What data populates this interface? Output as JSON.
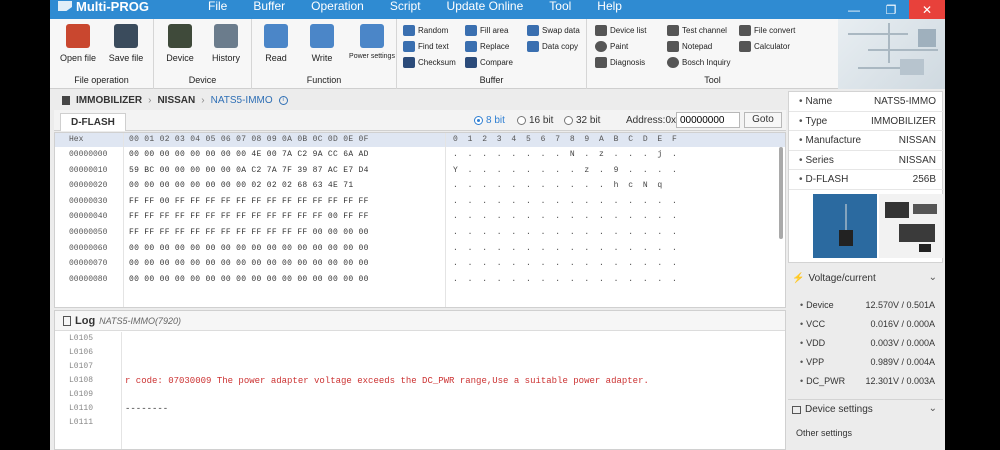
{
  "window": {
    "app_title": "Multi-PROG",
    "menus": [
      "File",
      "Buffer",
      "Operation",
      "Script",
      "Update Online",
      "Tool",
      "Help"
    ],
    "min_glyph": "—",
    "max_glyph": "❐",
    "close_glyph": "✕"
  },
  "ribbon": {
    "file_operation": {
      "label": "File operation",
      "open": "Open file",
      "save": "Save file"
    },
    "device": {
      "label": "Device",
      "device": "Device",
      "history": "History"
    },
    "function": {
      "label": "Function",
      "read": "Read",
      "write": "Write",
      "power": "Power settings"
    },
    "buffer": {
      "label": "Buffer",
      "random": "Random",
      "find_text": "Find text",
      "checksum": "Checksum",
      "fill_area": "Fill area",
      "replace": "Replace",
      "compare": "Compare",
      "swap_data": "Swap data",
      "data_copy": "Data copy"
    },
    "tool": {
      "label": "Tool",
      "device_list": "Device list",
      "paint": "Paint",
      "diagnosis": "Diagnosis",
      "test_channel": "Test channel",
      "notepad": "Notepad",
      "bosch_inquiry": "Bosch Inquiry",
      "file_convert": "File convert",
      "calculator": "Calculator"
    }
  },
  "breadcrumb": {
    "part1": "IMMOBILIZER",
    "part2": "NISSAN",
    "part3": "NATS5-IMMO"
  },
  "hex_view": {
    "tab": "D-FLASH",
    "bit_options": [
      "8 bit",
      "16 bit",
      "32 bit"
    ],
    "address_label": "Address:0x",
    "address_value": "00000000",
    "goto": "Goto",
    "header_hex": "Hex",
    "header_cols": "00 01 02 03 04 05 06 07 08 09 0A 0B 0C 0D 0E 0F",
    "header_ascii": "0 1 2 3 4 5 6 7 8 9 A B C D E F",
    "rows": [
      {
        "addr": "00000000",
        "hex": "00 00 00 00 00 00 00 00 4E 00 7A C2 9A CC 6A AD",
        "ascii": ". . . . . . . . N . z . . . j ."
      },
      {
        "addr": "00000010",
        "hex": "59 BC 00 00 00 00 00 0A C2 7A 7F 39 87 AC E7 D4",
        "ascii": "Y . . . . . . . . z . 9 . . . ."
      },
      {
        "addr": "00000020",
        "hex": "00 00 00 00 00 00 00 00 02 02 02 68 63 4E 71 ",
        "ascii": ". . . . . . . . . . . h c N q"
      },
      {
        "addr": "00000030",
        "hex": "FF FF 00 FF FF FF FF FF FF FF FF FF FF FF FF FF",
        "ascii": ". . . . . . . . . . . . . . . ."
      },
      {
        "addr": "00000040",
        "hex": "FF FF FF FF FF FF FF FF FF FF FF FF FF 00 FF FF",
        "ascii": ". . . . . . . . . . . . . . . ."
      },
      {
        "addr": "00000050",
        "hex": "FF FF FF FF FF FF FF FF FF FF FF FF 00 00 00 00",
        "ascii": ". . . . . . . . . . . . . . . ."
      },
      {
        "addr": "00000060",
        "hex": "00 00 00 00 00 00 00 00 00 00 00 00 00 00 00 00",
        "ascii": ". . . . . . . . . . . . . . . ."
      },
      {
        "addr": "00000070",
        "hex": "00 00 00 00 00 00 00 00 00 00 00 00 00 00 00 00",
        "ascii": ". . . . . . . . . . . . . . . ."
      },
      {
        "addr": "00000080",
        "hex": "00 00 00 00 00 00 00 00 00 00 00 00 00 00 00 00",
        "ascii": ". . . . . . . . . . . . . . . ."
      }
    ]
  },
  "log": {
    "title": "Log",
    "subtitle": "NATS5-IMMO(7920)",
    "line_numbers": [
      "L0105",
      "L0106",
      "L0107",
      "L0108",
      "L0109",
      "L0110",
      "L0111"
    ],
    "lines": [
      "",
      "",
      "",
      "r code: 07030009 The power adapter voltage exceeds the DC_PWR range,Use a suitable power adapter.",
      "",
      "--------",
      ""
    ]
  },
  "device_info": {
    "name_k": "Name",
    "name_v": "NATS5-IMMO",
    "type_k": "Type",
    "type_v": "IMMOBILIZER",
    "manufacture_k": "Manufacture",
    "manufacture_v": "NISSAN",
    "series_k": "Series",
    "series_v": "NISSAN",
    "flash_k": "D-FLASH",
    "flash_v": "256B"
  },
  "voltage": {
    "title": "Voltage/current",
    "rows": [
      {
        "k": "Device",
        "v": "12.570V / 0.501A"
      },
      {
        "k": "VCC",
        "v": "0.016V / 0.000A"
      },
      {
        "k": "VDD",
        "v": "0.003V / 0.000A"
      },
      {
        "k": "VPP",
        "v": "0.989V / 0.004A"
      },
      {
        "k": "DC_PWR",
        "v": "12.301V / 0.003A"
      }
    ]
  },
  "device_settings": {
    "title": "Device settings",
    "other": "Other settings"
  },
  "colors": {
    "titlebar": "#2f8bd2",
    "close": "#e8413b",
    "accent": "#2f7fd2",
    "error": "#cc3333"
  }
}
